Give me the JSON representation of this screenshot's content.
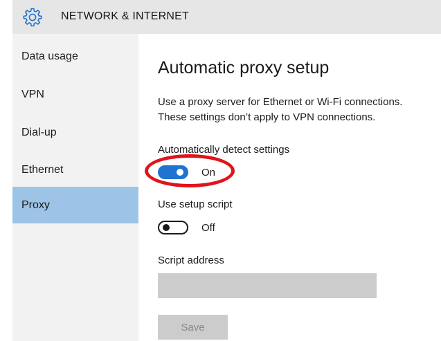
{
  "header": {
    "title": "NETWORK & INTERNET",
    "icon": "gear-icon",
    "accent": "#1f73d1"
  },
  "sidebar": {
    "items": [
      {
        "label": "Data usage",
        "selected": false
      },
      {
        "label": "VPN",
        "selected": false
      },
      {
        "label": "Dial-up",
        "selected": false
      },
      {
        "label": "Ethernet",
        "selected": false
      },
      {
        "label": "Proxy",
        "selected": true
      }
    ],
    "selected_color": "#9dc4e6"
  },
  "main": {
    "title": "Automatic proxy setup",
    "description": [
      "Use a proxy server for Ethernet or Wi-Fi connections.",
      "These settings don’t apply to VPN connections."
    ],
    "auto_detect": {
      "label": "Automatically detect settings",
      "state": "On",
      "checked": true
    },
    "setup_script": {
      "label": "Use setup script",
      "state": "Off",
      "checked": false
    },
    "script_address": {
      "label": "Script address",
      "value": ""
    },
    "save_label": "Save",
    "annotation_color": "#e0141c"
  }
}
